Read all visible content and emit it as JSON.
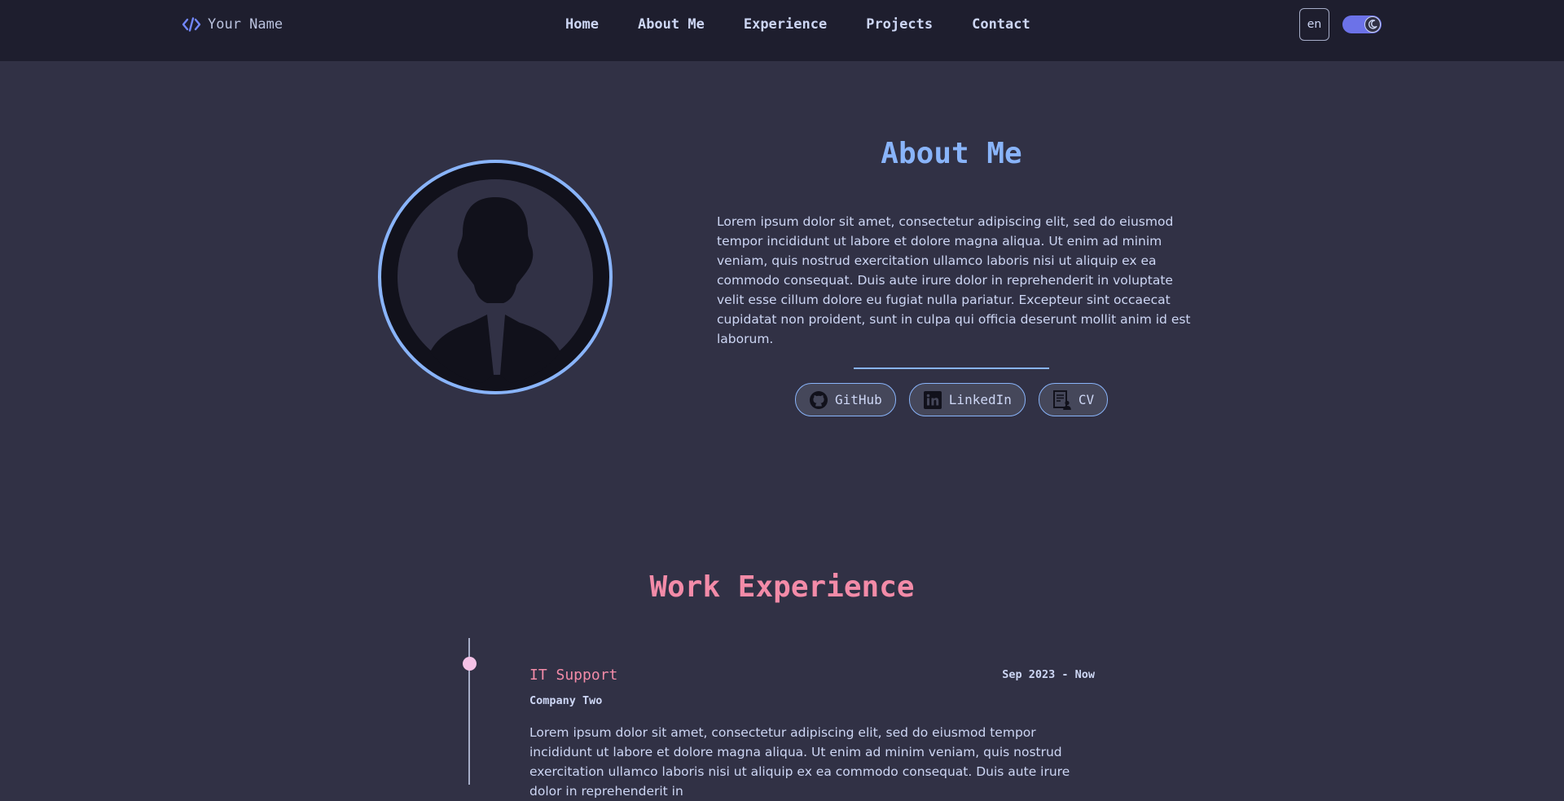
{
  "navbar": {
    "brand_label": "Your Name",
    "links": [
      "Home",
      "About Me",
      "Experience",
      "Projects",
      "Contact"
    ],
    "language": "en",
    "theme_toggle_state": "dark"
  },
  "about": {
    "title": "About Me",
    "text": "Lorem ipsum dolor sit amet, consectetur adipiscing elit, sed do eiusmod tempor incididunt ut labore et dolore magna aliqua. Ut enim ad minim veniam, quis nostrud exercitation ullamco laboris nisi ut aliquip ex ea commodo consequat. Duis aute irure dolor in reprehenderit in voluptate velit esse cillum dolore eu fugiat nulla pariatur. Excepteur sint occaecat cupidatat non proident, sunt in culpa qui officia deserunt mollit anim id est laborum.",
    "social": [
      {
        "label": "GitHub",
        "icon": "github-icon"
      },
      {
        "label": "LinkedIn",
        "icon": "linkedin-icon"
      },
      {
        "label": "CV",
        "icon": "cv-document-icon"
      }
    ]
  },
  "experience": {
    "title": "Work Experience",
    "jobs": [
      {
        "title": "IT Support",
        "date": "Sep 2023 - Now",
        "company": "Company Two",
        "description": "Lorem ipsum dolor sit amet, consectetur adipiscing elit, sed do eiusmod tempor incididunt ut labore et dolore magna aliqua. Ut enim ad minim veniam, quis nostrud exercitation ullamco laboris nisi ut aliquip ex ea commodo consequat. Duis aute irure dolor in reprehenderit in"
      }
    ]
  },
  "colors": {
    "nav_bg": "#1e1e2e",
    "page_bg": "#313145",
    "accent_blue": "#89b4fa",
    "accent_pink": "#f38ba8",
    "timeline_dot": "#f5c2e7"
  }
}
